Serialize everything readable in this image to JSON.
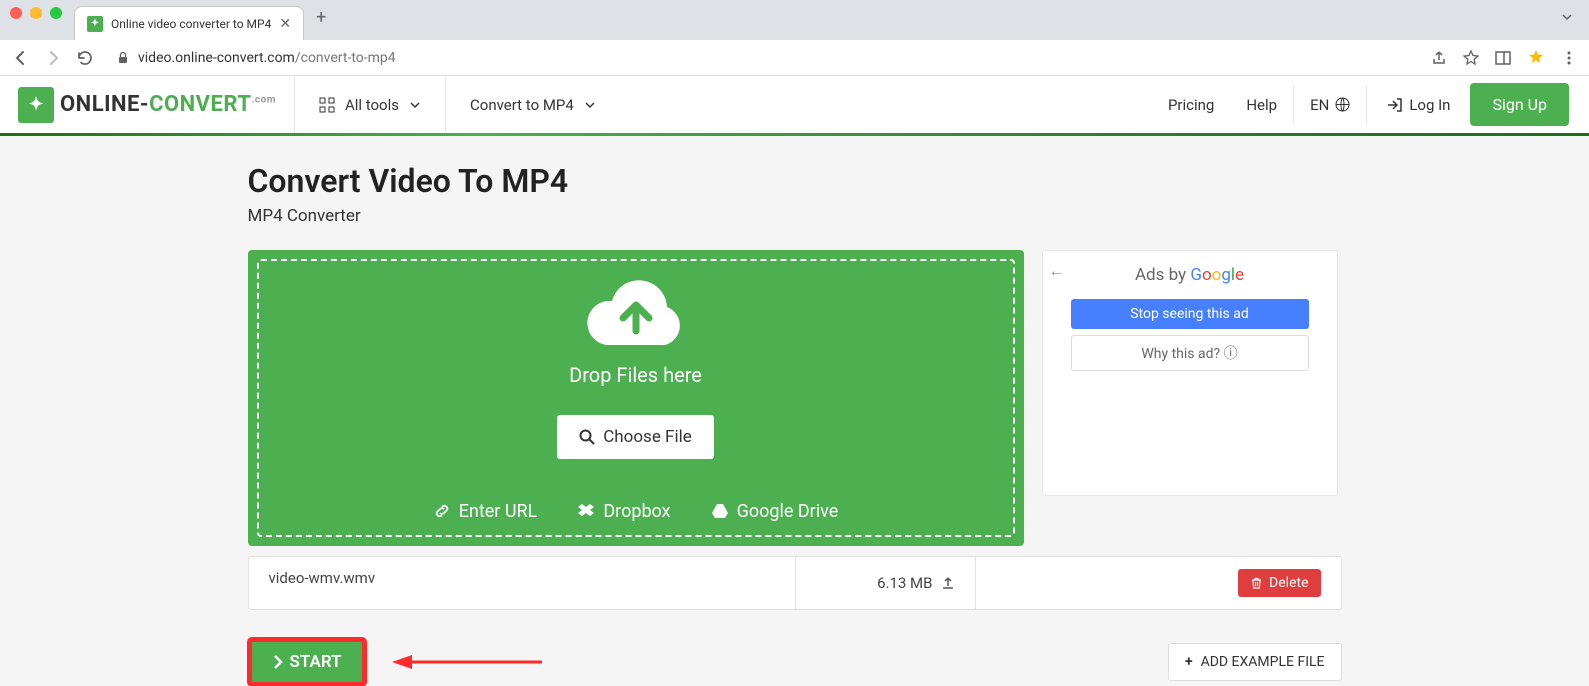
{
  "browser": {
    "tab_title": "Online video converter to MP4",
    "url_domain": "video.online-convert.com",
    "url_path": "/convert-to-mp4"
  },
  "header": {
    "logo_online": "ONLINE-",
    "logo_convert": "CONVERT",
    "logo_suffix": ".com",
    "all_tools": "All tools",
    "convert_to": "Convert to MP4",
    "pricing": "Pricing",
    "help": "Help",
    "lang": "EN",
    "login": "Log In",
    "signup": "Sign Up"
  },
  "page": {
    "title": "Convert Video To MP4",
    "subtitle": "MP4 Converter"
  },
  "dropzone": {
    "drop_text": "Drop Files here",
    "choose": "Choose File",
    "enter_url": "Enter URL",
    "dropbox": "Dropbox",
    "gdrive": "Google Drive"
  },
  "ad": {
    "by": "Ads by ",
    "stop": "Stop seeing this ad",
    "why": "Why this ad? ⓘ"
  },
  "file": {
    "name": "video-wmv.wmv",
    "size": "6.13 MB",
    "delete": "Delete"
  },
  "actions": {
    "start": "START",
    "add_example": "ADD EXAMPLE FILE"
  }
}
